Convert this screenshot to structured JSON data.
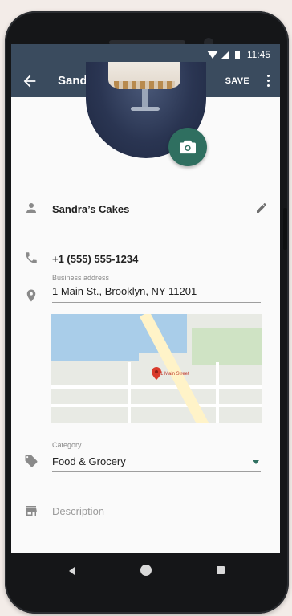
{
  "status_bar": {
    "time": "11:45"
  },
  "app_bar": {
    "title": "Sandra’s Cakes",
    "save_label": "SAVE"
  },
  "profile": {
    "name": "Sandra’s Cakes",
    "phone": "+1 (555) 555-1234",
    "address_label": "Business address",
    "address_value": "1 Main St., Brooklyn, NY 11201",
    "map_pin_label": "1 Main Street",
    "category_label": "Category",
    "category_value": "Food & Grocery",
    "description_placeholder": "Description"
  },
  "colors": {
    "app_bar": "#3a4b5e",
    "accent": "#2f6f60",
    "phone_body": "#151618"
  }
}
